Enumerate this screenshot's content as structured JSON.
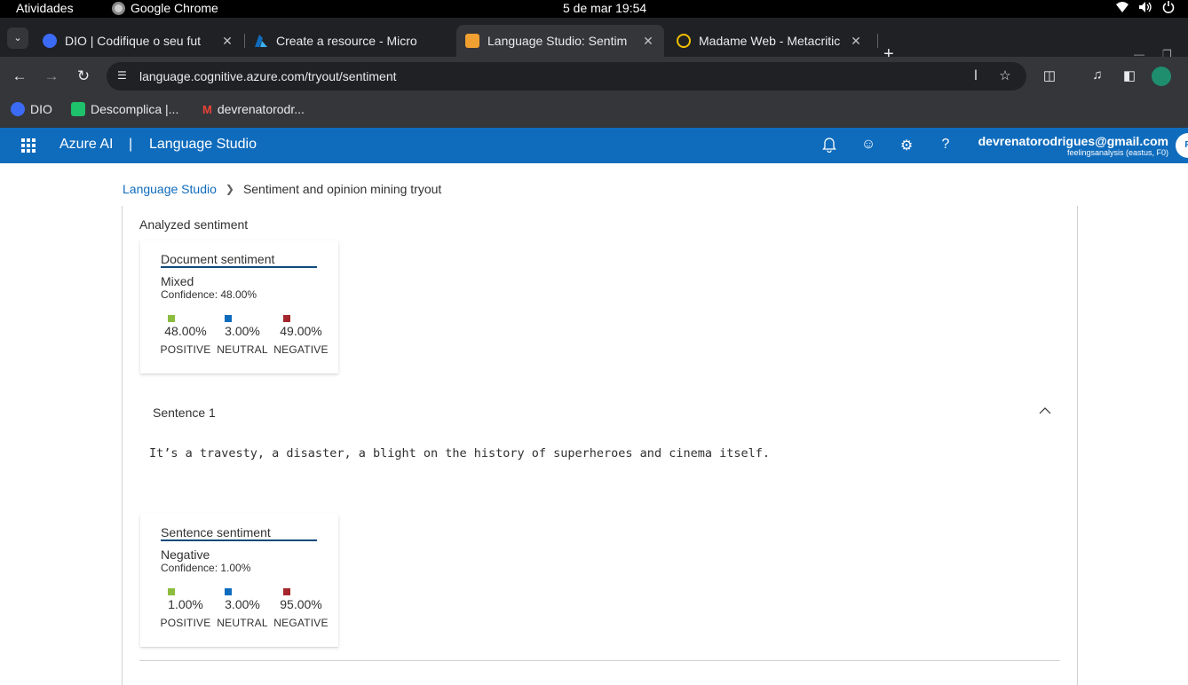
{
  "system": {
    "activities": "Atividades",
    "app_name": "Google Chrome",
    "clock": "5 de mar  19:54"
  },
  "tabs": [
    {
      "title": "DIO | Codifique o seu fut",
      "favicon_color": "#3b6bf5"
    },
    {
      "title": "Create a resource - Micro",
      "favicon_color": "#0f6cbd"
    },
    {
      "title": "Language Studio: Sentim",
      "favicon_color": "#f0a030"
    },
    {
      "title": "Madame Web - Metacritic",
      "favicon_color": "#f2c200"
    }
  ],
  "toolbar": {
    "url": "language.cognitive.azure.com/tryout/sentiment"
  },
  "bookmarks": [
    {
      "label": "DIO",
      "color": "#3b6bf5"
    },
    {
      "label": "Descomplica |...",
      "color": "#1ec26a"
    },
    {
      "label": "devrenatorodr...",
      "color": "#ea4335"
    }
  ],
  "header": {
    "brand": "Azure AI",
    "pipe": "|",
    "product": "Language Studio",
    "user_email": "devrenatorodrigues@gmail.com",
    "user_resource": "feelingsanalysis (eastus, F0)",
    "avatar_initial": "R",
    "accent": "#0f6cbd"
  },
  "breadcrumb": {
    "root": "Language Studio",
    "current": "Sentiment and opinion mining tryout"
  },
  "analysis": {
    "section_title": "Analyzed sentiment",
    "colors": {
      "positive": "#8cbd3f",
      "neutral": "#0f6cbd",
      "negative": "#a4262c"
    },
    "document": {
      "title": "Document sentiment",
      "label": "Mixed",
      "confidence": "Confidence: 48.00%",
      "positive": "48.00%",
      "neutral": "3.00%",
      "negative": "49.00%"
    },
    "metric_labels": {
      "positive": "POSITIVE",
      "neutral": "NEUTRAL",
      "negative": "NEGATIVE"
    },
    "sentence": {
      "heading": "Sentence 1",
      "text": "It’s a travesty, a disaster, a blight on the history of superheroes and cinema itself.",
      "title": "Sentence sentiment",
      "label": "Negative",
      "confidence": "Confidence: 1.00%",
      "positive": "1.00%",
      "neutral": "3.00%",
      "negative": "95.00%"
    }
  }
}
